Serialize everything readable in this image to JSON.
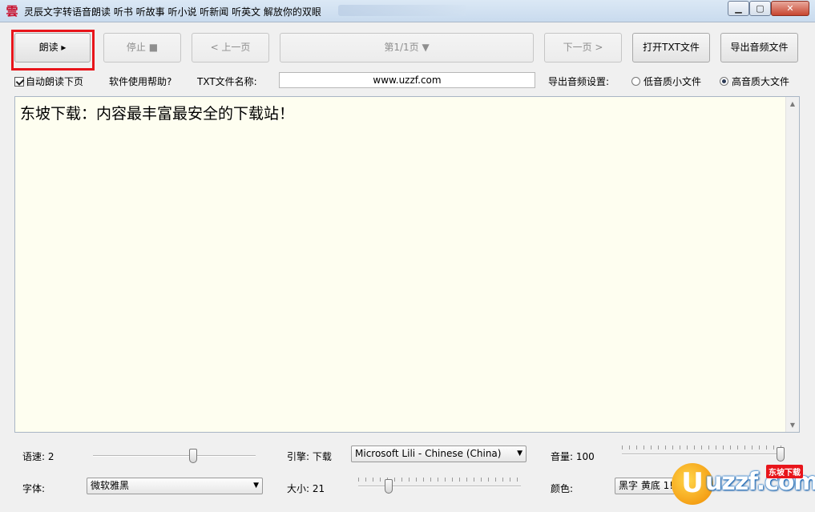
{
  "window": {
    "title": "灵辰文字转语音朗读   听书 听故事 听小说 听新闻 听英文 解放你的双眼",
    "app_icon_glyph": "雲",
    "min_glyph": "▁",
    "max_glyph": "▢",
    "close_glyph": "✕"
  },
  "toolbar": {
    "read_label": "朗读 ▸",
    "stop_label": "停止 ■",
    "prev_label": "< 上一页",
    "page_label": "第1/1页 ▼",
    "next_label": "下一页 >",
    "open_label": "打开TXT文件",
    "export_label": "导出音频文件"
  },
  "options": {
    "auto_read_label": "自动朗读下页",
    "auto_read_checked": true,
    "help_label": "软件使用帮助?",
    "filename_label": "TXT文件名称:",
    "filename_value": "www.uzzf.com",
    "audio_setting_label": "导出音频设置:",
    "low_quality_label": "低音质小文件",
    "high_quality_label": "高音质大文件",
    "selected_quality": "high"
  },
  "editor": {
    "content": "东坡下载：内容最丰富最安全的下载站！",
    "scroll_up": "▲",
    "scroll_down": "▼"
  },
  "controls": {
    "speed_label": "语速: 2",
    "speed_level": 0.62,
    "engine_label": "引擎: 下载",
    "engine_value": "Microsoft Lili - Chinese (China)",
    "volume_label": "音量: 100",
    "volume_level": 1.0,
    "font_label": "字体:",
    "font_value": "微软雅黑",
    "size_label": "大小: 21",
    "size_level": 0.17,
    "color_label": "颜色:",
    "color_value": "黑字 黄底 1!",
    "dropdown_glyph": "▼"
  },
  "watermark": {
    "letter": "U",
    "text": "uzzf.com",
    "badge": "东坡下载"
  },
  "colors": {
    "highlight": "#e8151b",
    "editor_bg": "#fefef0",
    "window_bg": "#f0f0f0"
  }
}
